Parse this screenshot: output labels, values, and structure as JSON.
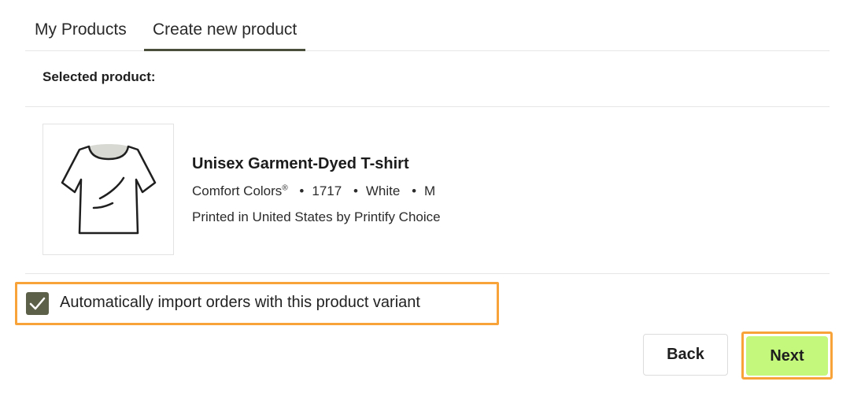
{
  "tabs": [
    {
      "label": "My Products",
      "active": false
    },
    {
      "label": "Create new product",
      "active": true
    }
  ],
  "section": {
    "label": "Selected product:"
  },
  "product": {
    "name": "Unisex Garment-Dyed T-shirt",
    "brand": "Comfort Colors",
    "brand_mark": "®",
    "model": "1717",
    "color": "White",
    "size": "M",
    "separator": "•",
    "printed_by": "Printed in United States by Printify Choice",
    "thumbnail_icon": "tshirt-icon"
  },
  "auto_import": {
    "label": "Automatically import orders with this product variant",
    "checked": true
  },
  "actions": {
    "back_label": "Back",
    "next_label": "Next"
  },
  "colors": {
    "accent_tab_underline": "#4a4f3c",
    "checkbox_fill": "#5d6048",
    "next_button_bg": "#c3f87c",
    "highlight_border": "#f7a33a"
  }
}
